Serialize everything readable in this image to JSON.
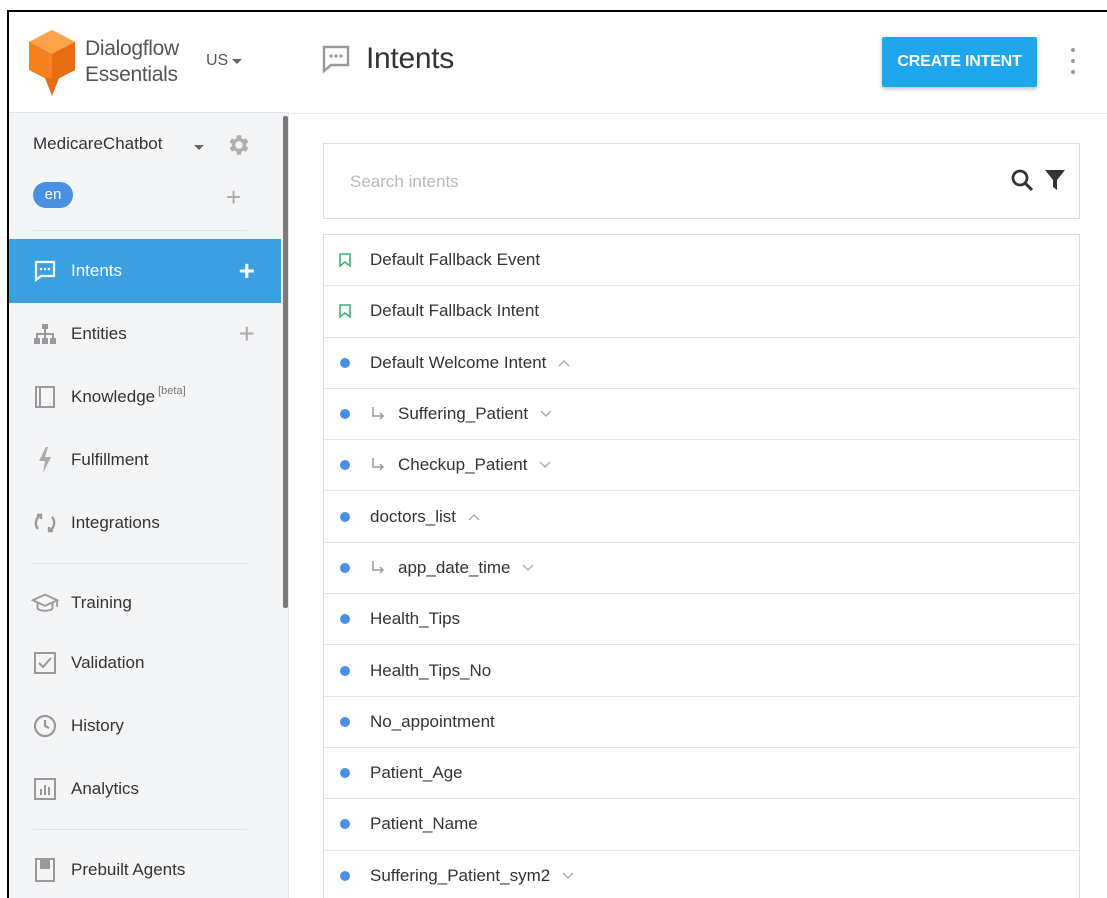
{
  "brand": {
    "line1": "Dialogflow",
    "line2": "Essentials",
    "region": "US"
  },
  "agent": {
    "name": "MedicareChatbot",
    "language": "en"
  },
  "nav": [
    {
      "label": "Intents",
      "icon": "intents-icon",
      "active": true,
      "addable": true
    },
    {
      "label": "Entities",
      "icon": "entities-icon",
      "active": false,
      "addable": true
    },
    {
      "label": "Knowledge",
      "badge": "[beta]",
      "icon": "knowledge-icon"
    },
    {
      "label": "Fulfillment",
      "icon": "fulfillment-icon"
    },
    {
      "label": "Integrations",
      "icon": "integrations-icon"
    },
    {
      "label": "Training",
      "icon": "training-icon"
    },
    {
      "label": "Validation",
      "icon": "validation-icon"
    },
    {
      "label": "History",
      "icon": "history-icon"
    },
    {
      "label": "Analytics",
      "icon": "analytics-icon"
    },
    {
      "label": "Prebuilt Agents",
      "icon": "prebuilt-agents-icon"
    }
  ],
  "header": {
    "title": "Intents",
    "create_label": "CREATE INTENT"
  },
  "search": {
    "placeholder": "Search intents"
  },
  "intents": [
    {
      "name": "Default Fallback Event",
      "kind": "fallback"
    },
    {
      "name": "Default Fallback Intent",
      "kind": "fallback"
    },
    {
      "name": "Default Welcome Intent",
      "kind": "normal",
      "expander": "up"
    },
    {
      "name": "Suffering_Patient",
      "kind": "child",
      "expander": "down"
    },
    {
      "name": "Checkup_Patient",
      "kind": "child",
      "expander": "down"
    },
    {
      "name": "doctors_list",
      "kind": "normal",
      "expander": "up"
    },
    {
      "name": "app_date_time",
      "kind": "child",
      "expander": "down"
    },
    {
      "name": "Health_Tips",
      "kind": "normal"
    },
    {
      "name": "Health_Tips_No",
      "kind": "normal"
    },
    {
      "name": "No_appointment",
      "kind": "normal"
    },
    {
      "name": "Patient_Age",
      "kind": "normal"
    },
    {
      "name": "Patient_Name",
      "kind": "normal"
    },
    {
      "name": "Suffering_Patient_sym2",
      "kind": "normal",
      "expander": "down"
    }
  ],
  "colors": {
    "accent": "#3ba0e2",
    "button": "#1fa7ee",
    "dot": "#4a90e2",
    "logo": "#f5821f"
  }
}
